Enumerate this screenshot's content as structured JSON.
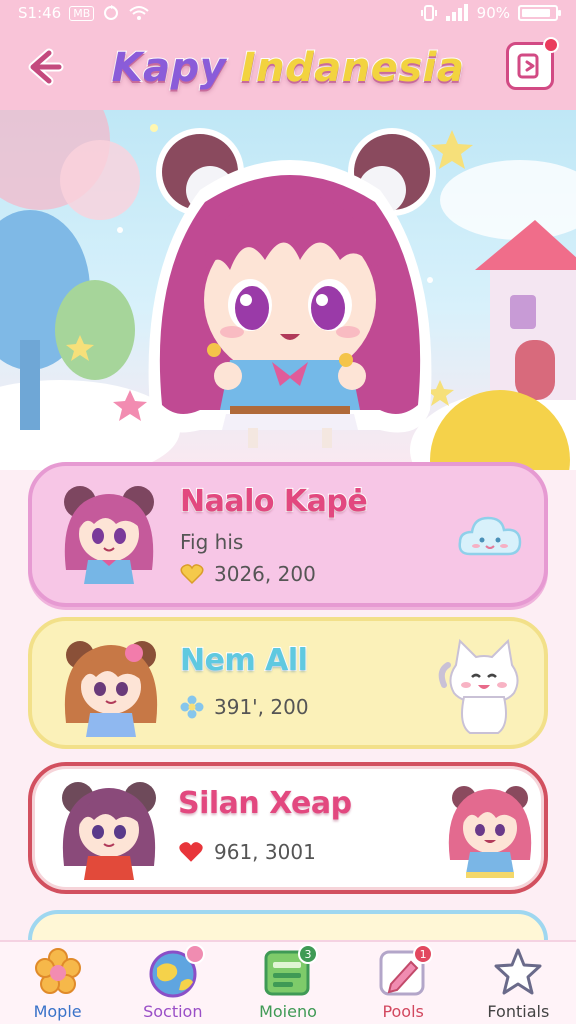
{
  "status_bar": {
    "time": "S1:46",
    "box_label": "MB",
    "battery_label": "90%",
    "battery_level": 0.9
  },
  "header": {
    "title_part1": "Kapy",
    "title_part2": "Indanesia",
    "back_icon": "arrow-left-icon",
    "exit_icon": "exit-icon"
  },
  "cards": [
    {
      "name": "Naalo Kapė",
      "subtitle": "Fig his",
      "stat_icon": "heart-icon",
      "stat": "3026, 200",
      "side_icon": "cloud-face-icon"
    },
    {
      "name": "Nem All",
      "stat_icon": "flower-icon",
      "stat": "391', 200",
      "side_icon": "cat-icon"
    },
    {
      "name": "Silan Xeap",
      "stat_icon": "heart-icon",
      "stat": "961, 3001",
      "side_icon": "chibi-girl-icon"
    }
  ],
  "bottom_nav": [
    {
      "label": "Mople",
      "icon": "flower-icon",
      "color": "#3a73c9",
      "badge": ""
    },
    {
      "label": "Soction",
      "icon": "globe-icon",
      "color": "#9a4fc7",
      "badge": ""
    },
    {
      "label": "Moieno",
      "icon": "notebook-icon",
      "color": "#3f9a55",
      "badge": "3"
    },
    {
      "label": "Pools",
      "icon": "pencil-icon",
      "color": "#d2485f",
      "badge": "1"
    },
    {
      "label": "Fontials",
      "icon": "star-icon",
      "color": "#444444",
      "badge": ""
    }
  ],
  "colors": {
    "header_bg": "#f9c4d8",
    "card1_bg": "#f7c6e6",
    "card2_bg": "#fbf1b9",
    "card3_border": "#d2505f",
    "accent_pink": "#e2487f"
  }
}
